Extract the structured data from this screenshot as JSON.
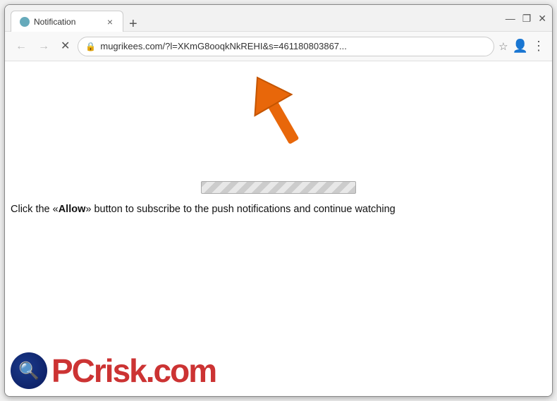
{
  "browser": {
    "title_bar": {
      "tab_title": "Notification",
      "tab_close_icon": "×",
      "new_tab_icon": "+",
      "win_minimize": "—",
      "win_restore": "❐",
      "win_close": "✕"
    },
    "nav_bar": {
      "back_icon": "←",
      "forward_icon": "→",
      "stop_icon": "✕",
      "lock_icon": "🔒",
      "address": "mugrikees.com/?l=XKmG8ooqkNkREHI&s=461180803867...",
      "star_icon": "☆",
      "profile_icon": "👤",
      "menu_icon": "⋮"
    },
    "page": {
      "notification_text": "Click the «Allow» button to subscribe to the push notifications and continue watching",
      "allow_label": "Allow",
      "watermark_text": "PC",
      "watermark_suffix": "risk.com"
    }
  }
}
